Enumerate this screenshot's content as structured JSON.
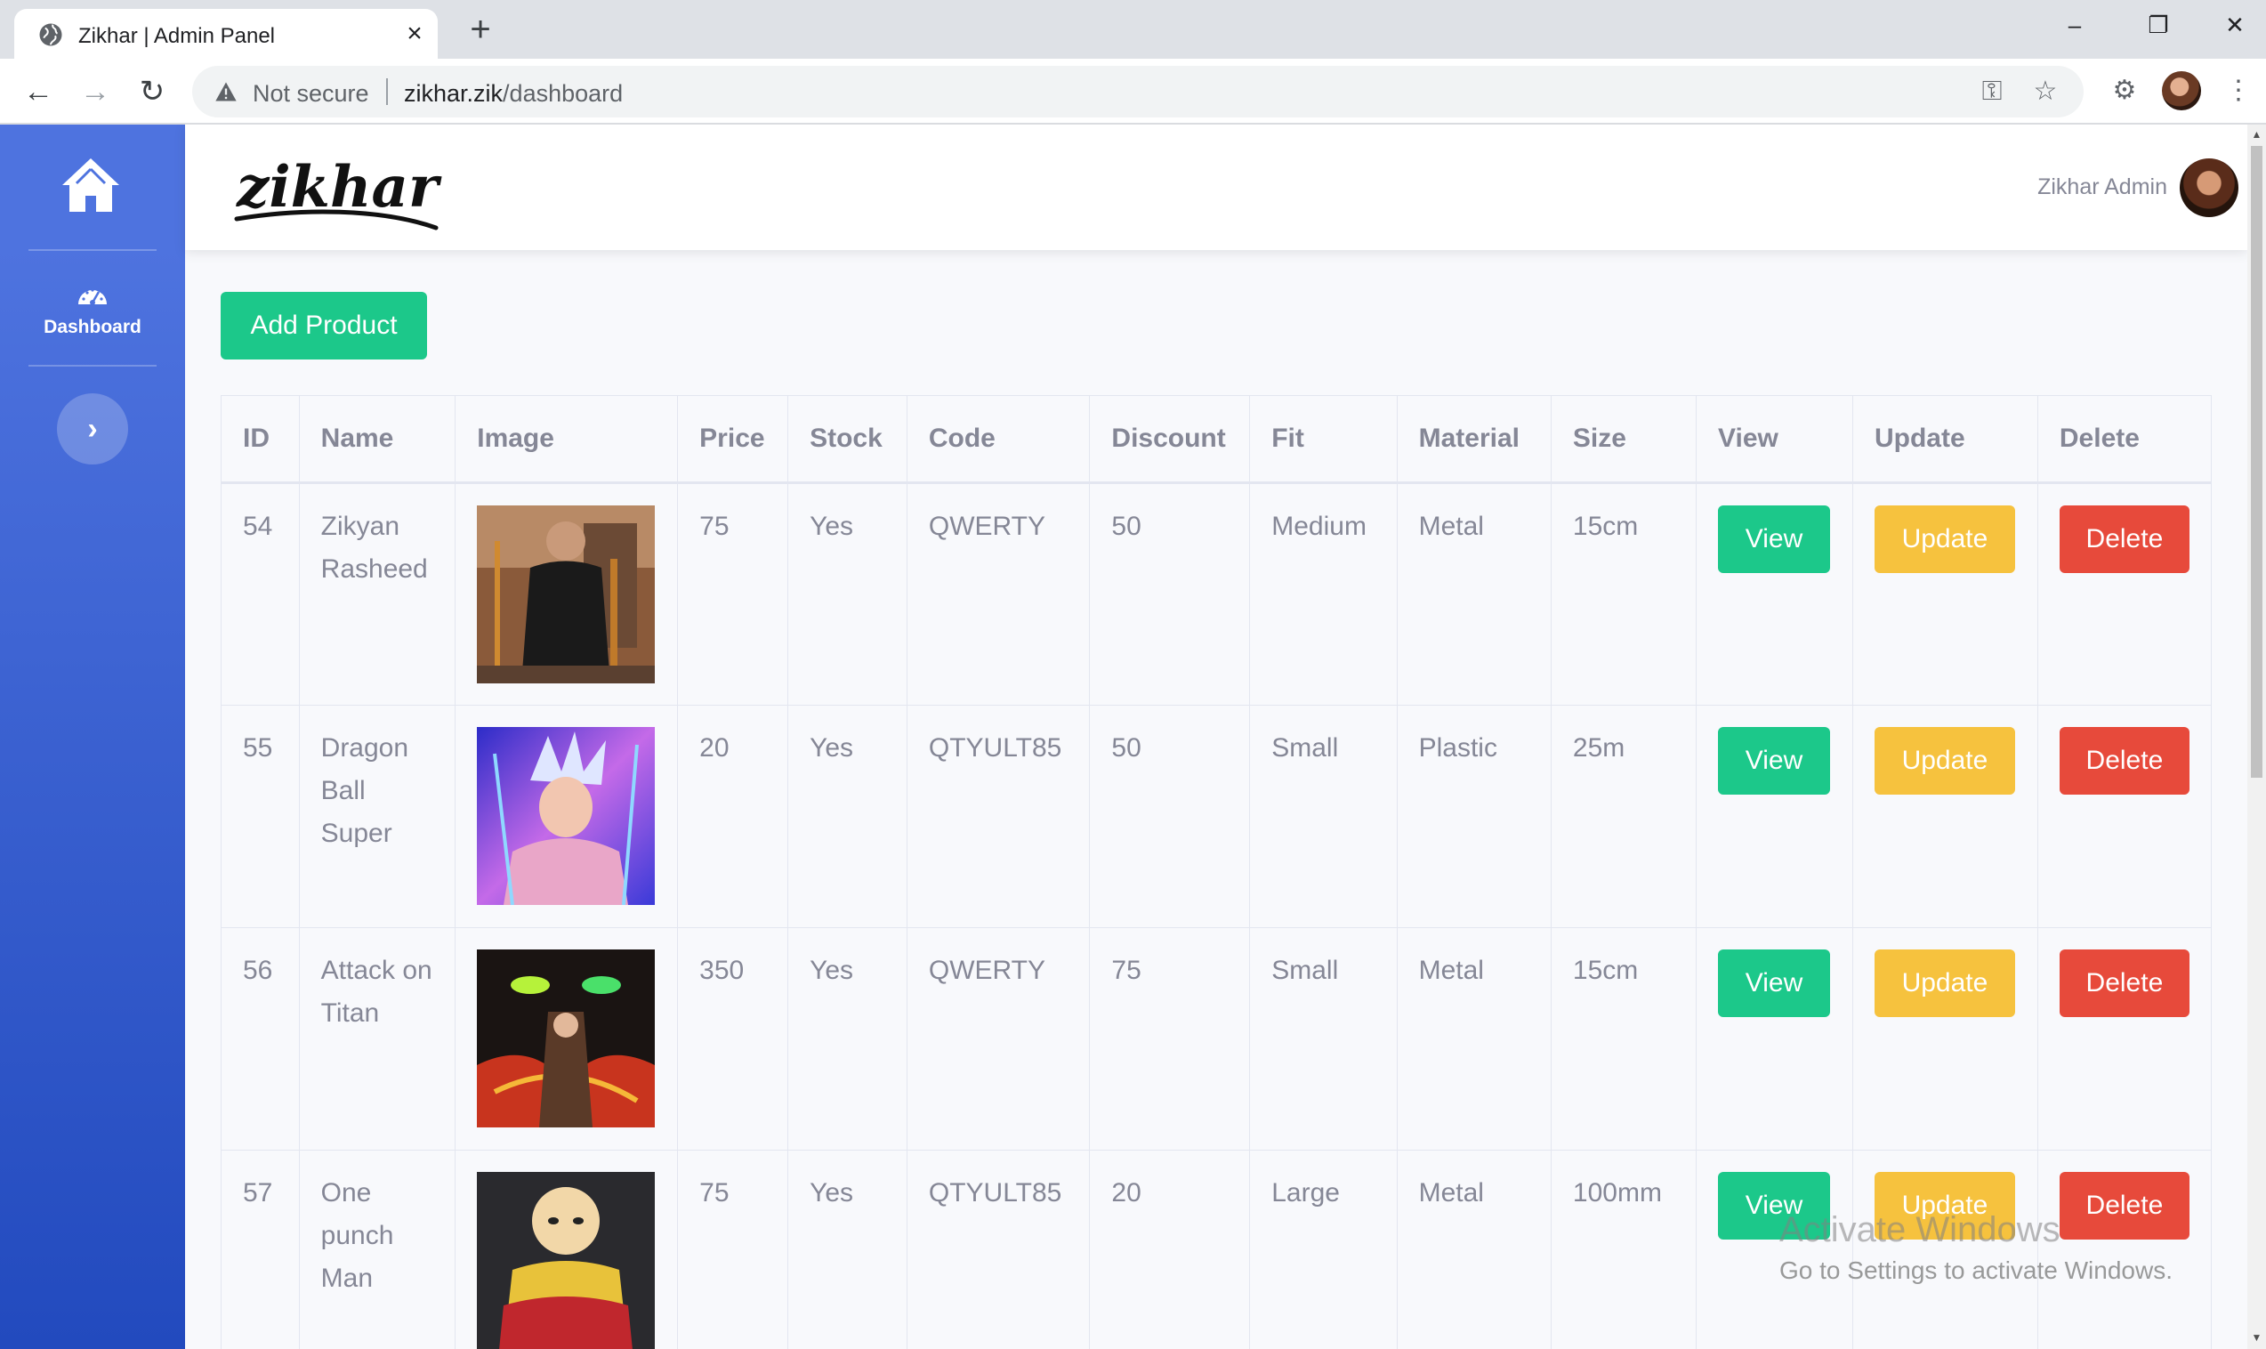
{
  "browser": {
    "tab_title": "Zikhar | Admin Panel",
    "tab_close": "×",
    "new_tab": "+",
    "window_minimize": "–",
    "window_restore": "❐",
    "window_close": "✕",
    "security_label": "Not secure",
    "url_host": "zikhar.zik",
    "url_path": "/dashboard"
  },
  "sidebar": {
    "nav_dashboard": "Dashboard",
    "toggle_glyph": "›"
  },
  "topbar": {
    "logo_text": "zikhar",
    "user_name": "Zikhar Admin"
  },
  "main": {
    "add_product_label": "Add Product",
    "columns": [
      "ID",
      "Name",
      "Image",
      "Price",
      "Stock",
      "Code",
      "Discount",
      "Fit",
      "Material",
      "Size",
      "View",
      "Update",
      "Delete"
    ],
    "rows": [
      {
        "id": "54",
        "name": "Zikyan Rasheed",
        "image": "gym-photo",
        "price": "75",
        "stock": "Yes",
        "code": "QWERTY",
        "discount": "50",
        "fit": "Medium",
        "material": "Metal",
        "size": "15cm",
        "view": "View",
        "update": "Update",
        "delete": "Delete"
      },
      {
        "id": "55",
        "name": "Dragon Ball Super",
        "image": "dragon-ball-art",
        "price": "20",
        "stock": "Yes",
        "code": "QTYULT85",
        "discount": "50",
        "fit": "Small",
        "material": "Plastic",
        "size": "25m",
        "view": "View",
        "update": "Update",
        "delete": "Delete"
      },
      {
        "id": "56",
        "name": "Attack on Titan",
        "image": "attack-on-titan-art",
        "price": "350",
        "stock": "Yes",
        "code": "QWERTY",
        "discount": "75",
        "fit": "Small",
        "material": "Metal",
        "size": "15cm",
        "view": "View",
        "update": "Update",
        "delete": "Delete"
      },
      {
        "id": "57",
        "name": "One punch Man",
        "image": "one-punch-man-art",
        "price": "75",
        "stock": "Yes",
        "code": "QTYULT85",
        "discount": "20",
        "fit": "Large",
        "material": "Metal",
        "size": "100mm",
        "view": "View",
        "update": "Update",
        "delete": "Delete"
      }
    ]
  },
  "watermark": {
    "title": "Activate Windows",
    "subtitle": "Go to Settings to activate Windows."
  },
  "colors": {
    "sidebar_start": "#4e73df",
    "sidebar_end": "#224abe",
    "success": "#1cc88a",
    "warning": "#f6c23e",
    "danger": "#e74a3b",
    "text_muted": "#858796"
  },
  "icons": {
    "tab_favicon": "globe-icon",
    "back": "arrow-left-icon",
    "forward": "arrow-right-icon",
    "reload": "reload-icon",
    "security": "warning-triangle-icon",
    "password": "key-icon",
    "bookmark": "star-icon",
    "extensions": "puzzle-icon",
    "menu": "kebab-menu-icon",
    "brand": "home-icon",
    "dashboard": "speedometer-icon",
    "toggle": "chevron-right-icon"
  }
}
